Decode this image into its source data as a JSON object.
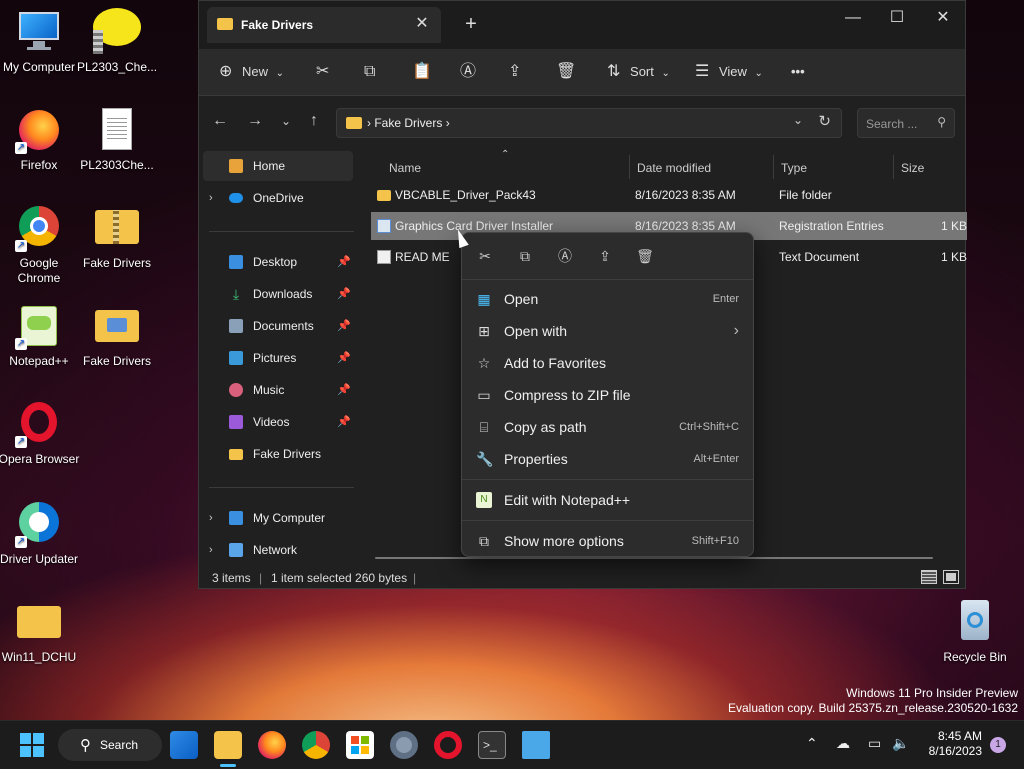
{
  "desktop": {
    "icons": [
      {
        "label": "My Computer"
      },
      {
        "label": "PL2303_Che..."
      },
      {
        "label": "Firefox"
      },
      {
        "label": "PL2303Che..."
      },
      {
        "label": "Google Chrome"
      },
      {
        "label": "Fake Drivers"
      },
      {
        "label": "Notepad++"
      },
      {
        "label": "Fake Drivers"
      },
      {
        "label": "Opera Browser"
      },
      {
        "label": "Driver Updater"
      },
      {
        "label": "Win11_DCHU"
      },
      {
        "label": "Recycle Bin"
      }
    ]
  },
  "explorer": {
    "tab_title": "Fake Drivers",
    "toolbar": {
      "new_label": "New",
      "sort_label": "Sort",
      "view_label": "View",
      "more_label": "•••"
    },
    "address": {
      "path": "Fake Drivers",
      "search_placeholder": "Search ..."
    },
    "sidebar": {
      "items": [
        {
          "label": "Home"
        },
        {
          "label": "OneDrive"
        },
        {
          "label": "Desktop"
        },
        {
          "label": "Downloads"
        },
        {
          "label": "Documents"
        },
        {
          "label": "Pictures"
        },
        {
          "label": "Music"
        },
        {
          "label": "Videos"
        },
        {
          "label": "Fake Drivers"
        },
        {
          "label": "My Computer"
        },
        {
          "label": "Network"
        }
      ]
    },
    "columns": {
      "name": "Name",
      "date": "Date modified",
      "type": "Type",
      "size": "Size"
    },
    "files": [
      {
        "name": "VBCABLE_Driver_Pack43",
        "date": "8/16/2023 8:35 AM",
        "type": "File folder",
        "size": ""
      },
      {
        "name": "Graphics Card Driver Installer",
        "date": "8/16/2023 8:35 AM",
        "type": "Registration Entries",
        "size": "1 KB"
      },
      {
        "name": "READ ME",
        "date": "",
        "type": "Text Document",
        "size": "1 KB"
      }
    ],
    "status": {
      "items": "3 items",
      "selected": "1 item selected  260 bytes"
    }
  },
  "context_menu": {
    "items": [
      {
        "label": "Open",
        "shortcut": "Enter"
      },
      {
        "label": "Open with",
        "shortcut": "›"
      },
      {
        "label": "Add to Favorites",
        "shortcut": ""
      },
      {
        "label": "Compress to ZIP file",
        "shortcut": ""
      },
      {
        "label": "Copy as path",
        "shortcut": "Ctrl+Shift+C"
      },
      {
        "label": "Properties",
        "shortcut": "Alt+Enter"
      },
      {
        "label": "Edit with Notepad++",
        "shortcut": ""
      },
      {
        "label": "Show more options",
        "shortcut": "Shift+F10"
      }
    ]
  },
  "watermark": {
    "line1": "Windows 11 Pro Insider Preview",
    "line2": "Evaluation copy. Build 25375.zn_release.230520-1632"
  },
  "taskbar": {
    "search_label": "Search",
    "time": "8:45 AM",
    "date": "8/16/2023",
    "notification_count": "1"
  },
  "colors": {
    "folder": "#f3c34a",
    "accent": "#4cc2ff",
    "selected_row": "#777777"
  }
}
